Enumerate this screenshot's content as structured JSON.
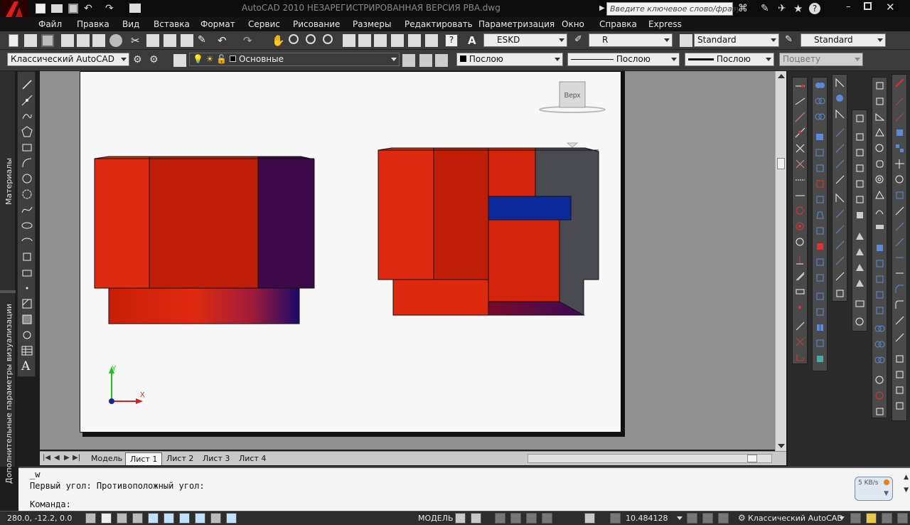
{
  "title": {
    "text": "AutoCAD 2010    НЕЗАРЕГИСТРИРОВАННАЯ ВЕРСИЯ      PBA.dwg",
    "search_placeholder": "Введите ключевое слово/фразу"
  },
  "menu": [
    "Файл",
    "Правка",
    "Вид",
    "Вставка",
    "Формат",
    "Сервис",
    "Рисование",
    "Размеры",
    "Редактировать",
    "Параметризация",
    "Окно",
    "Справка",
    "Express"
  ],
  "toolbar": {
    "text_style": "ESKD",
    "dim_style": "R",
    "table_style": "Standard",
    "mleader_style": "Standard"
  },
  "properties": {
    "workspace": "Классический AutoCAD",
    "layer": "Основные",
    "color": "Послою",
    "linetype": "Послою",
    "lineweight": "Послою",
    "plotstyle": "Поцвету"
  },
  "palettes": {
    "materials": "Материалы",
    "visual_styles": "Дополнительные параметры визуализации"
  },
  "viewcube": {
    "face": "Верх"
  },
  "ucs": {
    "x": "X",
    "y": "Y"
  },
  "layout_tabs": [
    "Модель",
    "Лист 1",
    "Лист 2",
    "Лист 3",
    "Лист 4"
  ],
  "active_tab": "Лист 1",
  "command": {
    "line1": "_w",
    "line2": "Первый угол: Противоположный угол:",
    "prompt": "Команда:"
  },
  "network_badge": "5 KB/s",
  "status": {
    "coords": "280.0, -12.2, 0.0",
    "model_label": "МОДЕЛЬ",
    "scale": "10.484128",
    "workspace": "Классический AutoCAD"
  },
  "colors": {
    "red_face": "#d92a10",
    "dark_red": "#b81c08",
    "purple": "#3d0a4a",
    "blue_key": "#0a2a9a",
    "gray_section": "#4a4a52"
  }
}
